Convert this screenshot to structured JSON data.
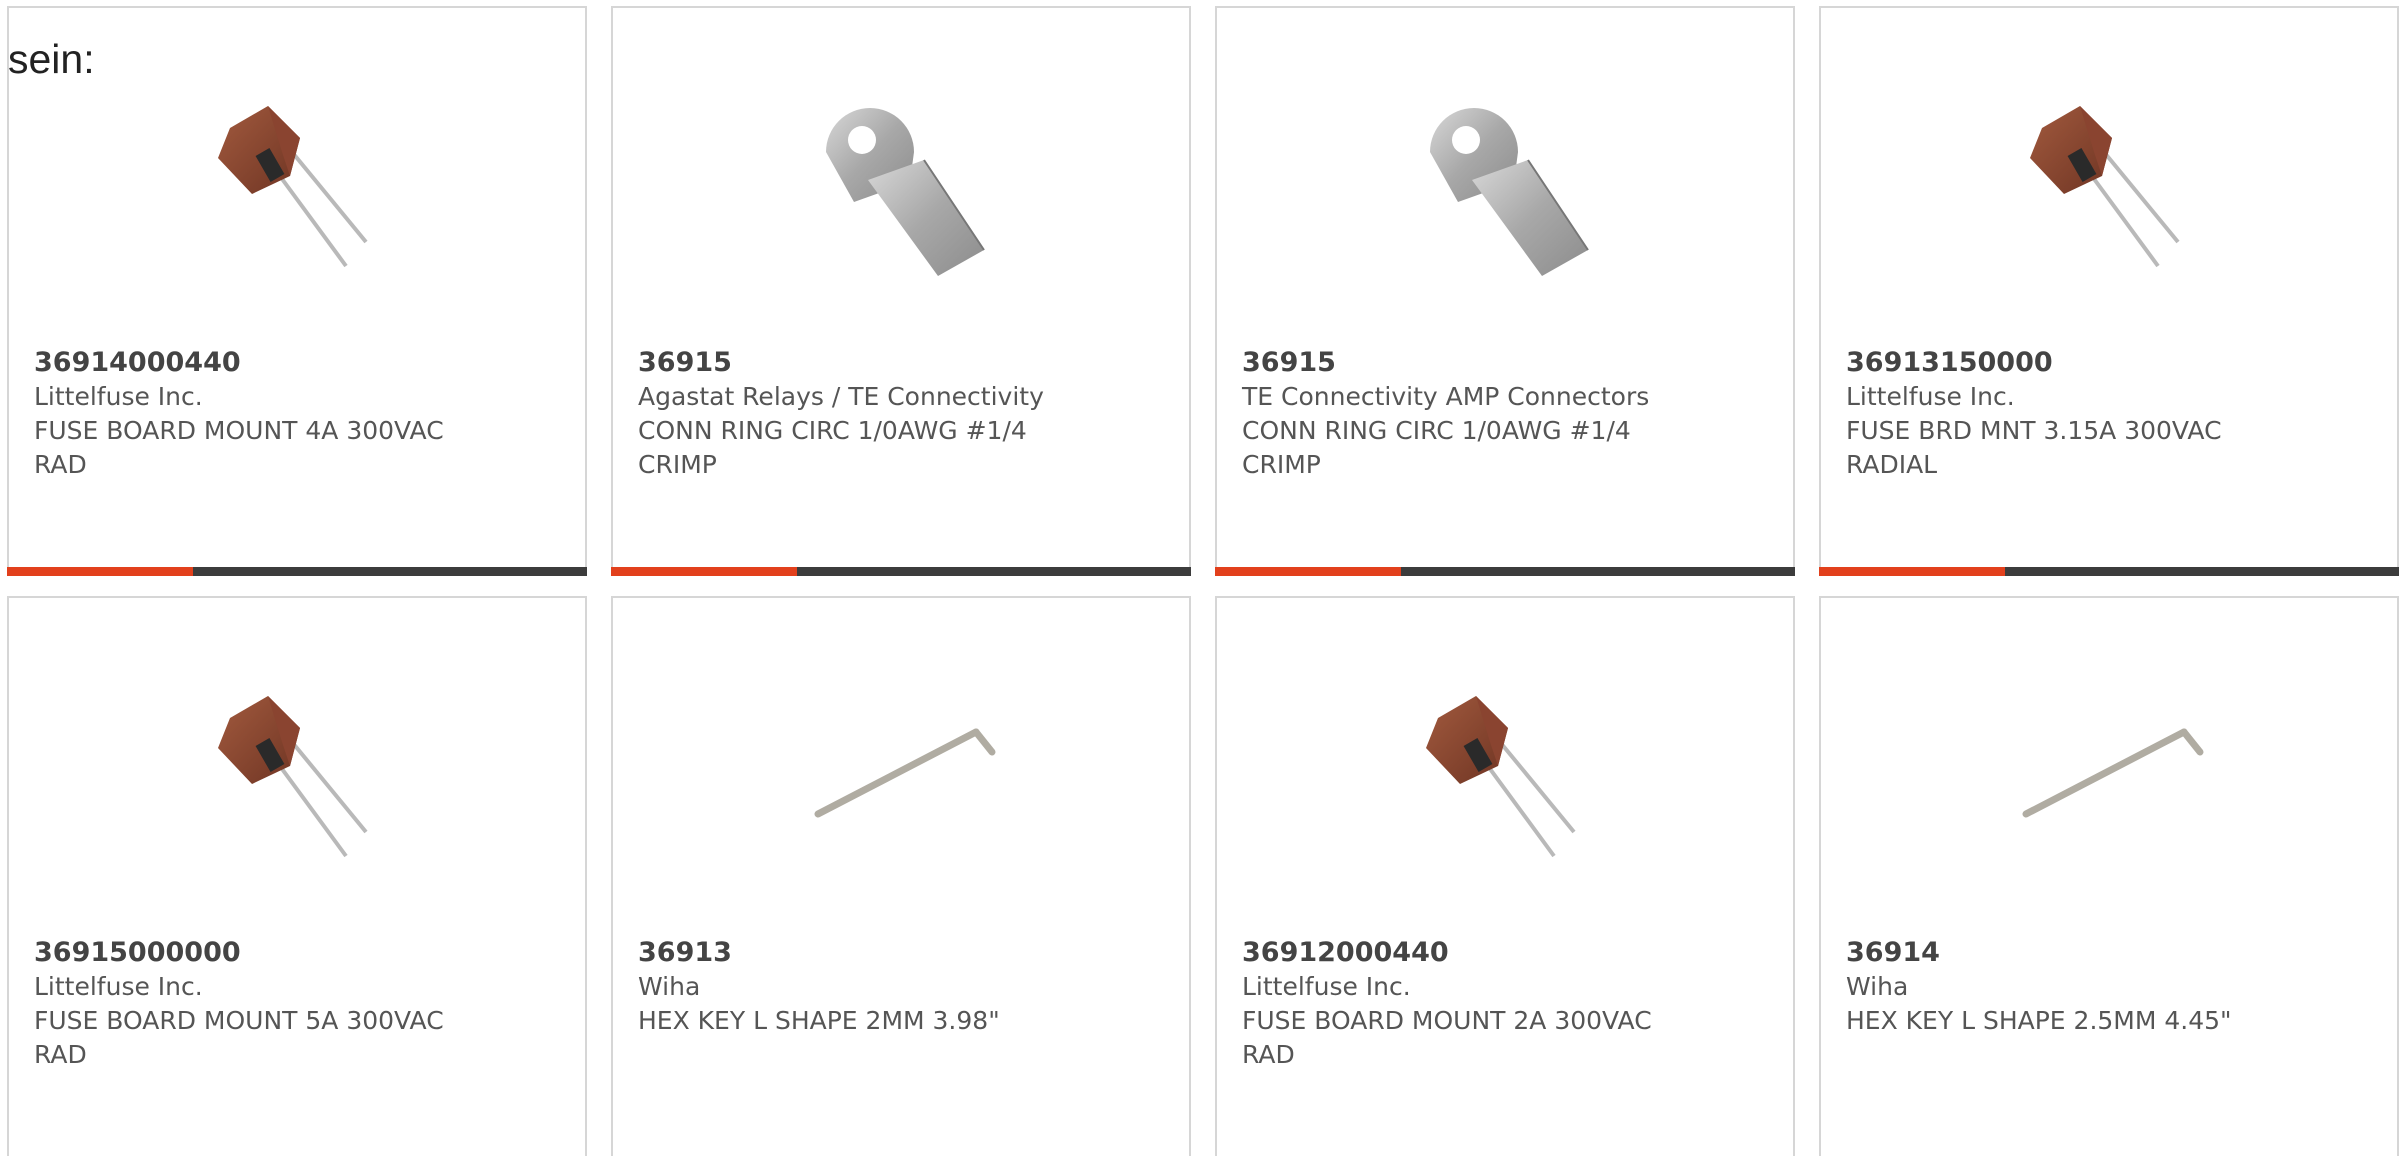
{
  "intro": "sein:",
  "accent_color": "#e2401c",
  "bar_color": "#3c3c3c",
  "products": [
    {
      "part_number": "36914000440",
      "manufacturer": "Littelfuse Inc.",
      "description": "FUSE BOARD MOUNT 4A 300VAC RAD",
      "image": "fuse-radial-icon",
      "bar_progress": 0.32
    },
    {
      "part_number": "36915",
      "manufacturer": "Agastat Relays / TE Connectivity",
      "description": "CONN RING CIRC 1/0AWG #1/4 CRIMP",
      "image": "ring-terminal-icon",
      "bar_progress": 0.32
    },
    {
      "part_number": "36915",
      "manufacturer": "TE Connectivity AMP Connectors",
      "description": "CONN RING CIRC 1/0AWG #1/4 CRIMP",
      "image": "ring-terminal-icon",
      "bar_progress": 0.32
    },
    {
      "part_number": "36913150000",
      "manufacturer": "Littelfuse Inc.",
      "description": "FUSE BRD MNT 3.15A 300VAC RADIAL",
      "image": "fuse-radial-icon",
      "bar_progress": 0.32
    },
    {
      "part_number": "36915000000",
      "manufacturer": "Littelfuse Inc.",
      "description": "FUSE BOARD MOUNT 5A 300VAC RAD",
      "image": "fuse-radial-icon"
    },
    {
      "part_number": "36913",
      "manufacturer": "Wiha",
      "description": "HEX KEY L SHAPE 2MM 3.98\"",
      "image": "hex-key-icon"
    },
    {
      "part_number": "36912000440",
      "manufacturer": "Littelfuse Inc.",
      "description": "FUSE BOARD MOUNT 2A 300VAC RAD",
      "image": "fuse-radial-icon"
    },
    {
      "part_number": "36914",
      "manufacturer": "Wiha",
      "description": "HEX KEY L SHAPE 2.5MM 4.45\"",
      "image": "hex-key-icon"
    }
  ]
}
